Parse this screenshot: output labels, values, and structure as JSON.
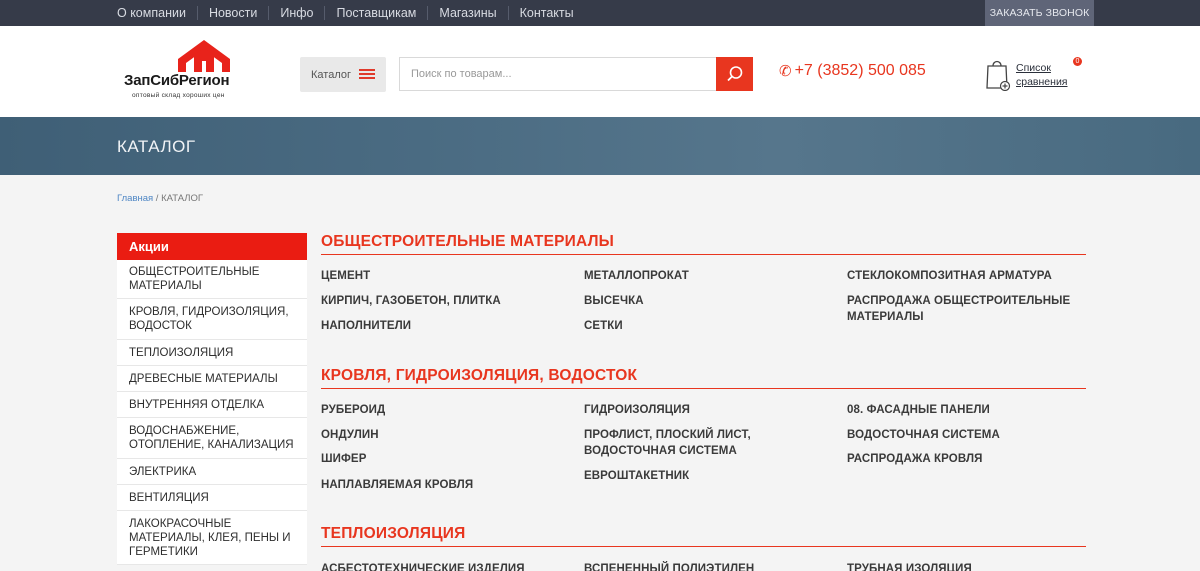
{
  "topnav": {
    "items": [
      "О компании",
      "Новости",
      "Инфо",
      "Поставщикам",
      "Магазины",
      "Контакты"
    ],
    "call_button": "ЗАКАЗАТЬ ЗВОНОК"
  },
  "header": {
    "logo_text": "ЗапСибРегион",
    "logo_tagline": "оптовый склад хороших цен",
    "catalog_button": "Каталог",
    "search_placeholder": "Поиск по товарам...",
    "phone": "+7 (3852) 500 085",
    "compare_line1": "Список",
    "compare_line2": "сравнения",
    "compare_count": "0"
  },
  "banner": {
    "title": "КАТАЛОГ"
  },
  "breadcrumb": {
    "home": "Главная",
    "separator": " / ",
    "current": "КАТАЛОГ"
  },
  "sidebar": {
    "header": "Акции",
    "items": [
      "ОБЩЕСТРОИТЕЛЬНЫЕ МАТЕРИАЛЫ",
      "КРОВЛЯ, ГИДРОИЗОЛЯЦИЯ, ВОДОСТОК",
      "ТЕПЛОИЗОЛЯЦИЯ",
      "ДРЕВЕСНЫЕ МАТЕРИАЛЫ",
      "ВНУТРЕННЯЯ ОТДЕЛКА",
      "ВОДОСНАБЖЕНИЕ, ОТОПЛЕНИЕ, КАНАЛИЗАЦИЯ",
      "ЭЛЕКТРИКА",
      "ВЕНТИЛЯЦИЯ",
      "ЛАКОКРАСОЧНЫЕ МАТЕРИАЛЫ, КЛЕЯ, ПЕНЫ И ГЕРМЕТИКИ"
    ]
  },
  "sections": [
    {
      "title": "ОБЩЕСТРОИТЕЛЬНЫЕ МАТЕРИАЛЫ",
      "col1": [
        "ЦЕМЕНТ",
        "КИРПИЧ, ГАЗОБЕТОН, ПЛИТКА",
        "НАПОЛНИТЕЛИ"
      ],
      "col2": [
        "МЕТАЛЛОПРОКАТ",
        "ВЫСЕЧКА",
        "СЕТКИ"
      ],
      "col3": [
        "СТЕКЛОКОМПОЗИТНАЯ АРМАТУРА",
        "РАСПРОДАЖА ОБЩЕСТРОИТЕЛЬНЫЕ МАТЕРИАЛЫ"
      ]
    },
    {
      "title": "КРОВЛЯ, ГИДРОИЗОЛЯЦИЯ, ВОДОСТОК",
      "col1": [
        "РУБЕРОИД",
        "ОНДУЛИН",
        "ШИФЕР",
        "НАПЛАВЛЯЕМАЯ КРОВЛЯ"
      ],
      "col2": [
        "ГИДРОИЗОЛЯЦИЯ",
        "ПРОФЛИСТ, ПЛОСКИЙ ЛИСТ, ВОДОСТОЧНАЯ СИСТЕМА",
        "ЕВРОШТАКЕТНИК"
      ],
      "col3": [
        "08. ФАСАДНЫЕ ПАНЕЛИ",
        "ВОДОСТОЧНАЯ СИСТЕМА",
        "РАСПРОДАЖА КРОВЛЯ"
      ]
    },
    {
      "title": "ТЕПЛОИЗОЛЯЦИЯ",
      "col1": [
        "АСБЕСТОТЕХНИЧЕСКИЕ ИЗДЕЛИЯ"
      ],
      "col2": [
        "ВСПЕНЕННЫЙ ПОЛИЭТИЛЕН"
      ],
      "col3": [
        "ТРУБНАЯ ИЗОЛЯЦИЯ"
      ]
    }
  ],
  "colors": {
    "accent": "#e8361f",
    "topbar": "#363b49",
    "sidebar_head": "#ea1c12"
  }
}
